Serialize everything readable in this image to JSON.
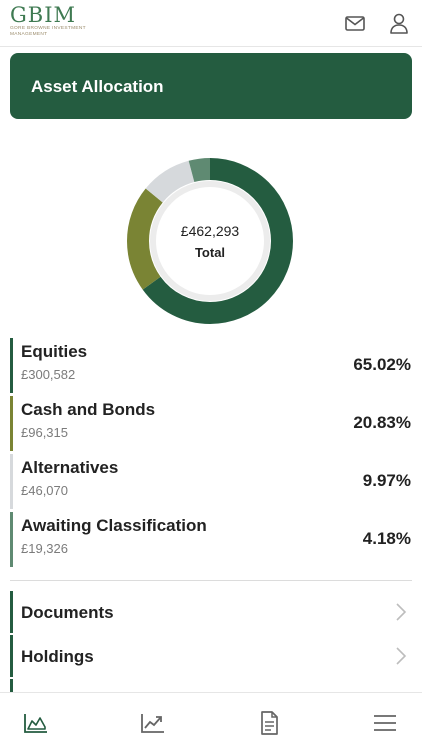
{
  "brand": {
    "logo_text": "GBIM",
    "tagline": "Gore Browne Investment Management"
  },
  "header": {
    "title": "Asset Allocation"
  },
  "donut": {
    "total_value": "£462,293",
    "total_label": "Total"
  },
  "allocations": [
    {
      "name": "Equities",
      "amount": "£300,582",
      "percent": "65.02%",
      "share": 65.02,
      "color": "#245c40"
    },
    {
      "name": "Cash and Bonds",
      "amount": "£96,315",
      "percent": "20.83%",
      "share": 20.83,
      "color": "#7a8434"
    },
    {
      "name": "Alternatives",
      "amount": "£46,070",
      "percent": "9.97%",
      "share": 9.97,
      "color": "#d6d9dc"
    },
    {
      "name": "Awaiting Classification",
      "amount": "£19,326",
      "percent": "4.18%",
      "share": 4.18,
      "color": "#5f8a72"
    }
  ],
  "nav": [
    {
      "label": "Documents"
    },
    {
      "label": "Holdings"
    }
  ],
  "icons": {
    "top": [
      "mail-icon",
      "user-icon"
    ],
    "bottom": [
      "area-chart-icon",
      "trend-icon",
      "document-icon",
      "menu-icon"
    ]
  },
  "colors": {
    "brand_green": "#245c40",
    "olive": "#7a8434"
  }
}
